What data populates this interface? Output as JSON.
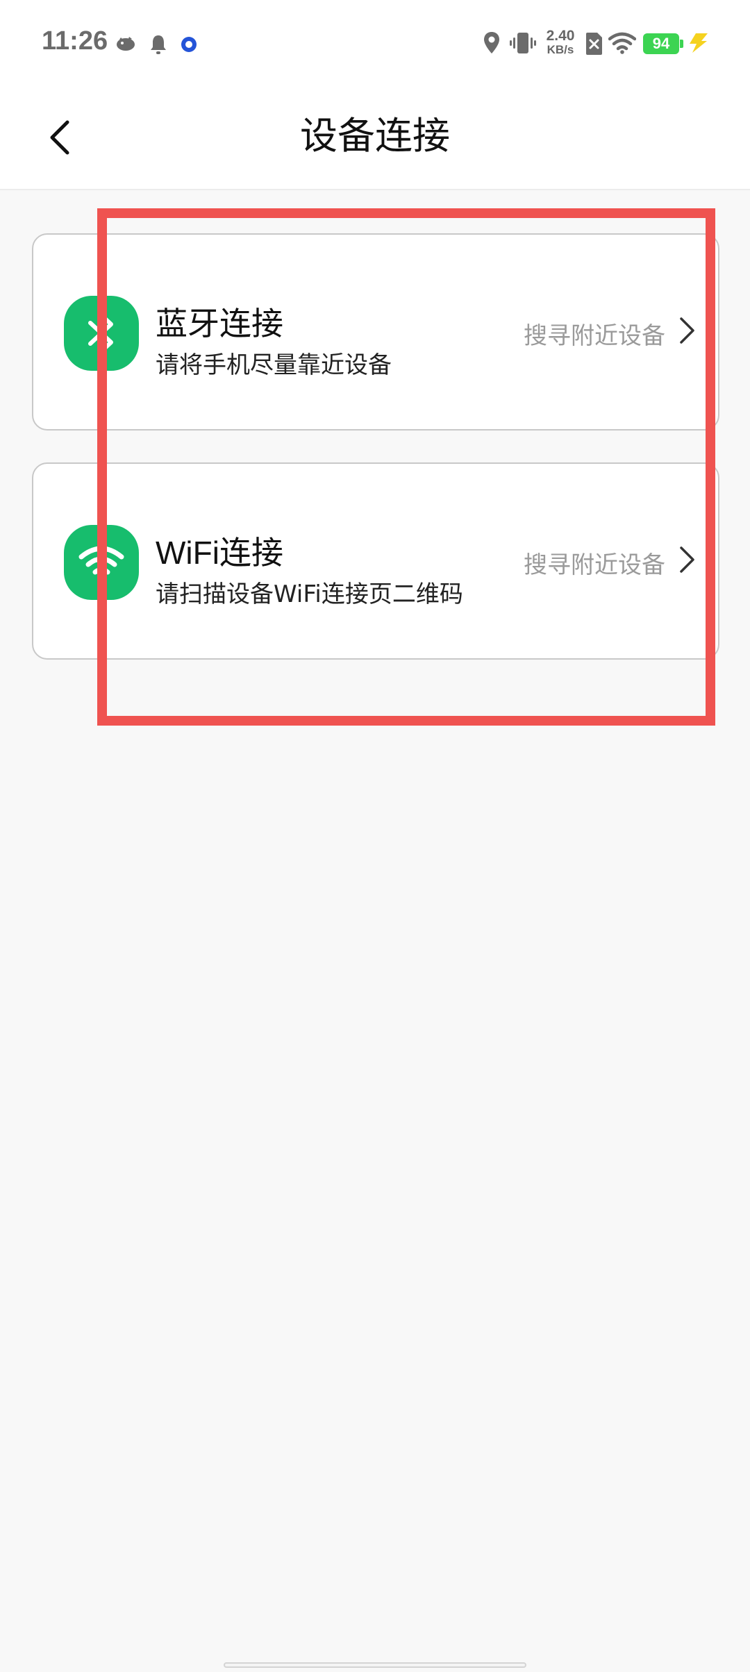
{
  "status_bar": {
    "time": "11:26",
    "net_speed_value": "2.40",
    "net_speed_unit": "KB/s",
    "battery_level": "94",
    "icons": [
      "fish-icon",
      "bell-icon",
      "app-dot-icon",
      "location-icon",
      "vibrate-icon",
      "sim-x-icon",
      "wifi-icon",
      "battery-icon",
      "charging-icon"
    ]
  },
  "header": {
    "title": "设备连接"
  },
  "connections": [
    {
      "title": "蓝牙连接",
      "subtitle": "请将手机尽量靠近设备",
      "action": "搜寻附近设备",
      "icon": "bluetooth-icon"
    },
    {
      "title": "WiFi连接",
      "subtitle": "请扫描设备WiFi连接页二维码",
      "action": "搜寻附近设备",
      "icon": "wifi-icon"
    }
  ],
  "colors": {
    "accent_green": "#17bd6d",
    "highlight_red": "#ef5350",
    "battery_green": "#3cd452",
    "background": "#f8f8f8"
  }
}
